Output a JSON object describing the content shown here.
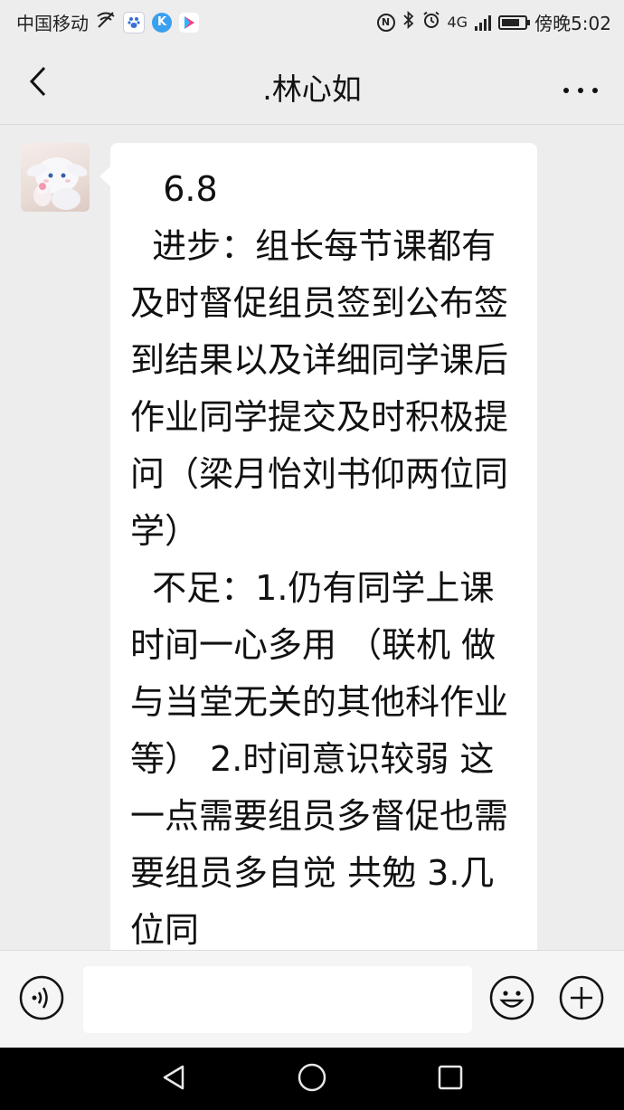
{
  "status_bar": {
    "carrier": "中国移动",
    "app_k_label": "K",
    "time": "傍晚5:02",
    "network": "4G",
    "nfc_label": "N",
    "battery_level": 0.8
  },
  "header": {
    "title": ".林心如"
  },
  "message": {
    "text": "   6.8\n  进步：组长每节课都有及时督促组员签到公布签到结果以及详细同学课后作业同学提交及时积极提问（梁月怡刘书仰两位同学）\n  不足：1.仍有同学上课时间一心多用 （联机 做与当堂无关的其他科作业等） 2.时间意识较弱 这一点需要组员多督促也需要组员多自觉 共勉 3.几位同"
  },
  "input": {
    "value": ""
  },
  "colors": {
    "background": "#ededed",
    "bubble": "#ffffff",
    "navbar": "#000000"
  },
  "icons": {
    "back": "chevron-left-icon",
    "more": "more-dots-icon",
    "voice": "voice-icon",
    "emoji": "emoji-icon",
    "plus": "plus-icon"
  }
}
